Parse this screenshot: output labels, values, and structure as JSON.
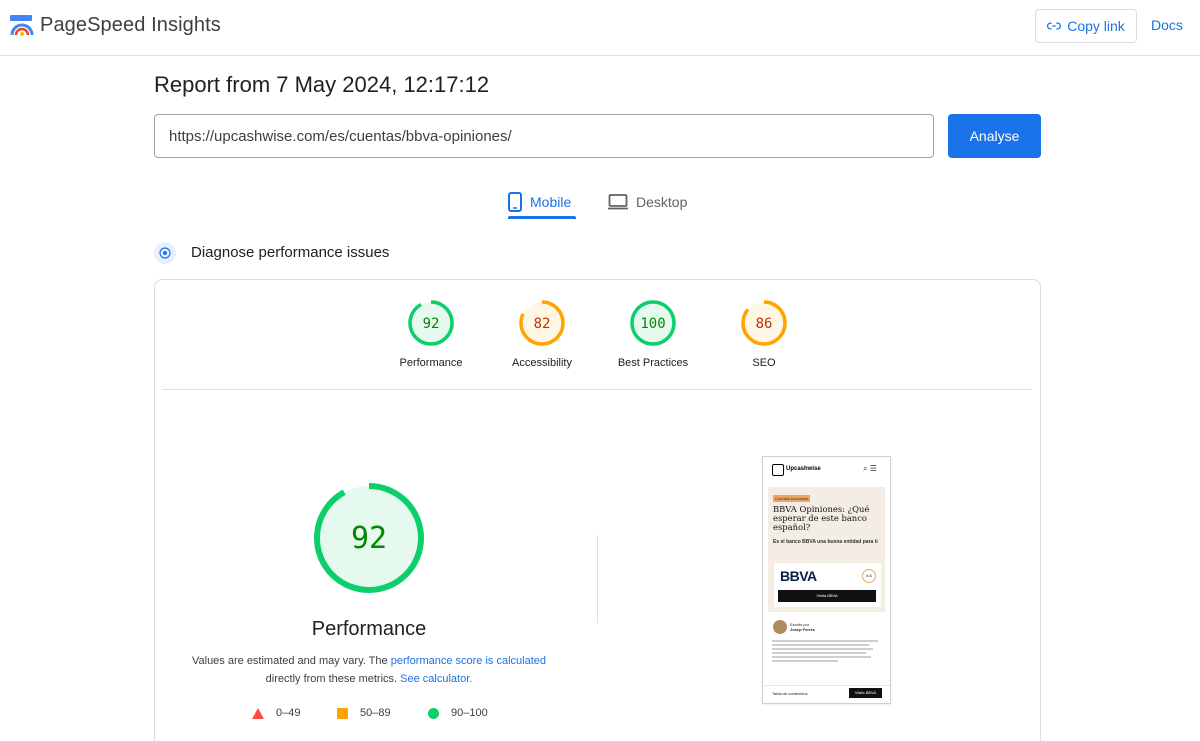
{
  "header": {
    "app_name": "PageSpeed Insights",
    "copy_link_label": "Copy link",
    "docs_label": "Docs"
  },
  "report": {
    "title": "Report from 7 May 2024, 12:17:12",
    "url": "https://upcashwise.com/es/cuentas/bbva-opiniones/",
    "analyse_label": "Analyse"
  },
  "tabs": {
    "mobile_label": "Mobile",
    "desktop_label": "Desktop",
    "active": "Mobile"
  },
  "diagnose": {
    "title": "Diagnose performance issues"
  },
  "scores": [
    {
      "label": "Performance",
      "value": "92",
      "status": "pass"
    },
    {
      "label": "Accessibility",
      "value": "82",
      "status": "average"
    },
    {
      "label": "Best Practices",
      "value": "100",
      "status": "pass"
    },
    {
      "label": "SEO",
      "value": "86",
      "status": "average"
    }
  ],
  "main": {
    "score": "92",
    "label": "Performance",
    "note_prefix": "Values are estimated and may vary. The ",
    "note_link1": "performance score is calculated",
    "note_mid": "directly from these metrics. ",
    "note_link2": "See calculator.",
    "legend": [
      {
        "range": "0–49",
        "color": "#ff4e42",
        "shape": "triangle"
      },
      {
        "range": "50–89",
        "color": "#ffa400",
        "shape": "square"
      },
      {
        "range": "90–100",
        "color": "#0cce6b",
        "shape": "circle"
      }
    ]
  },
  "thumbnail": {
    "brand": "Upcashwise",
    "tag": "Cuentas bancarias",
    "headline": "BBVA Opiniones: ¿Qué esperar de este banco español?",
    "subhead": "Es el banco BBVA una buena entidad para ti",
    "bank_name": "BBVA",
    "rating": "4.6",
    "visit_label": "Visita BBVA",
    "author_line1": "Escrito por",
    "author_line2": "Josep Ferrés",
    "toc_label": "Tabla de contenidos",
    "visit_label2": "Visita BBVA"
  },
  "colors": {
    "accent": "#1a73e8",
    "pass": "#0cce6b",
    "pass_text": "#008800",
    "average": "#ffa400",
    "average_text": "#c33300",
    "fail": "#ff4e42"
  }
}
